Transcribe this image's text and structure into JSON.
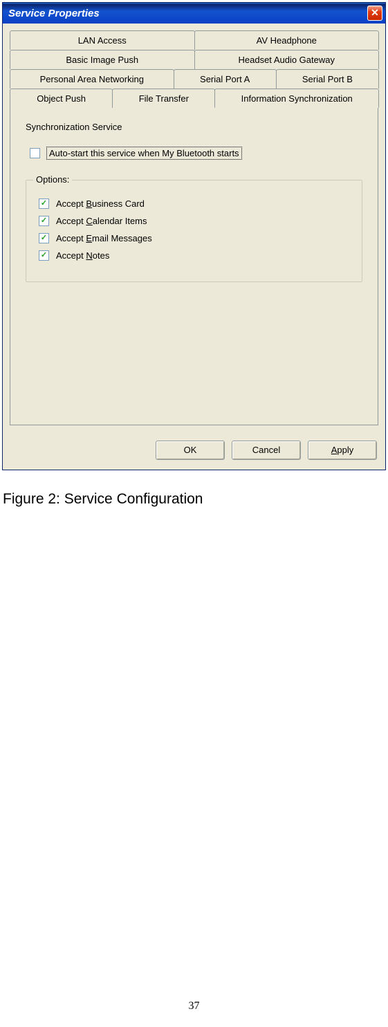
{
  "window": {
    "title": "Service Properties",
    "close": "✕"
  },
  "tabs": {
    "row1": [
      "LAN Access",
      "AV Headphone"
    ],
    "row2": [
      "Basic Image Push",
      "Headset Audio Gateway"
    ],
    "row3": [
      "Personal Area Networking",
      "Serial Port A",
      "Serial Port B"
    ],
    "row4": [
      "Object Push",
      "File Transfer",
      "Information Synchronization"
    ]
  },
  "panel": {
    "section_title": "Synchronization Service",
    "autostart_label": "Auto-start this service when My Bluetooth starts",
    "autostart_checked": false,
    "options_legend": "Options:",
    "options": [
      {
        "label_pre": "Accept ",
        "mn": "B",
        "label_post": "usiness Card",
        "checked": true
      },
      {
        "label_pre": "Accept ",
        "mn": "C",
        "label_post": "alendar Items",
        "checked": true
      },
      {
        "label_pre": "Accept ",
        "mn": "E",
        "label_post": "mail Messages",
        "checked": true
      },
      {
        "label_pre": "Accept ",
        "mn": "N",
        "label_post": "otes",
        "checked": true
      }
    ]
  },
  "buttons": {
    "ok": "OK",
    "cancel": "Cancel",
    "apply_pre": "",
    "apply_mn": "A",
    "apply_post": "pply"
  },
  "caption": "Figure 2: Service Configuration",
  "page_number": "37"
}
